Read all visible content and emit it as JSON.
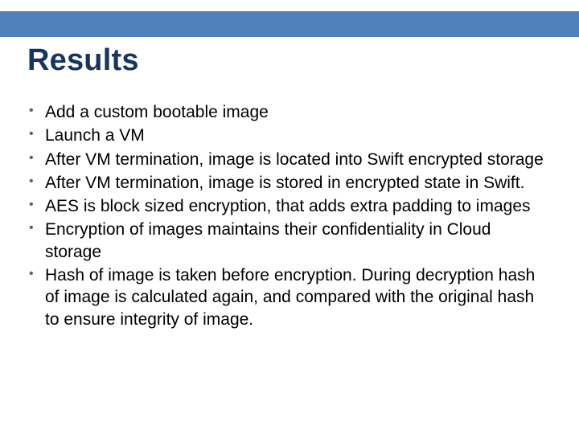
{
  "accent_color": "#4f81bd",
  "title_color": "#17365d",
  "title": "Results",
  "bullets": [
    "Add a custom bootable image",
    "Launch a VM",
    "After VM termination, image is located into Swift encrypted storage",
    "After VM termination, image is stored in encrypted state in Swift.",
    "AES is block sized encryption, that adds extra padding to images",
    "Encryption of images maintains their confidentiality in Cloud storage",
    "Hash of image is taken before encryption. During decryption hash of image is calculated again, and compared with the original hash to ensure integrity of image."
  ]
}
